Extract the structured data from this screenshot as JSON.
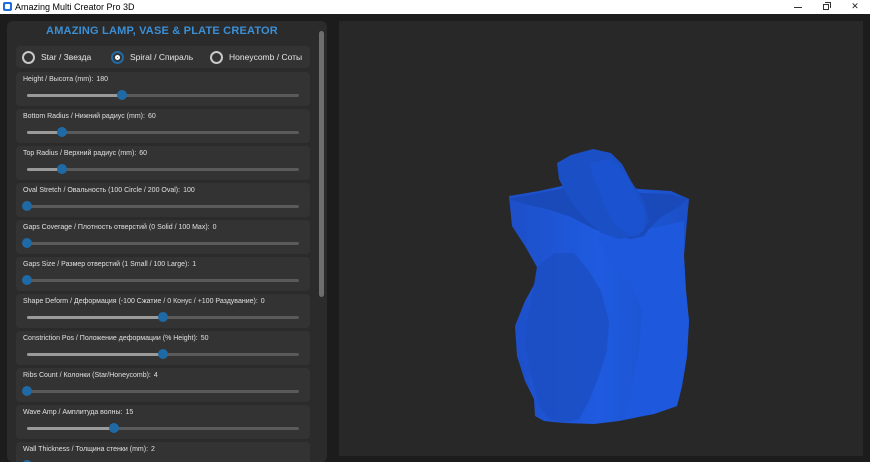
{
  "window": {
    "title": "Amazing Multi Creator Pro 3D"
  },
  "panel": {
    "title": "AMAZING LAMP, VASE & PLATE CREATOR"
  },
  "shape_modes": [
    {
      "label": "Star / Звезда",
      "checked": false
    },
    {
      "label": "Spiral / Спираль",
      "checked": true
    },
    {
      "label": "Honeycomb / Соты",
      "checked": false
    }
  ],
  "sliders": [
    {
      "label": "Height / Высота (mm):",
      "value": "180",
      "level": 0.35
    },
    {
      "label": "Bottom Radius / Нижний радиус (mm):",
      "value": "60",
      "level": 0.13
    },
    {
      "label": "Top Radius / Верхний радиус (mm):",
      "value": "60",
      "level": 0.13
    },
    {
      "label": "Oval Stretch / Овальность (100 Circle / 200 Oval):",
      "value": "100",
      "level": 0.0
    },
    {
      "label": "Gaps Coverage / Плотность отверстий (0 Solid / 100 Max):",
      "value": "0",
      "level": 0.0
    },
    {
      "label": "Gaps Size / Размер отверстий (1 Small / 100 Large):",
      "value": "1",
      "level": 0.0
    },
    {
      "label": "Shape Deform / Деформация (-100 Сжатие / 0 Конус / +100 Раздувание):",
      "value": "0",
      "level": 0.5
    },
    {
      "label": "Constriction Pos / Положение деформации (% Height):",
      "value": "50",
      "level": 0.5
    },
    {
      "label": "Ribs Count / Колонки (Star/Honeycomb):",
      "value": "4",
      "level": 0.0
    },
    {
      "label": "Wave Amp / Амплитуда волны:",
      "value": "15",
      "level": 0.32
    },
    {
      "label": "Wall Thickness / Толщина стенки (mm):",
      "value": "2",
      "level": 0.0
    }
  ],
  "colors": {
    "accent": "#1f6aa5",
    "title": "#3a8fd6",
    "model": "#1e55d6"
  },
  "icons": {
    "app": "app-icon",
    "minimize": "minimize-icon",
    "maximize": "restore-icon",
    "close": "close-icon"
  }
}
